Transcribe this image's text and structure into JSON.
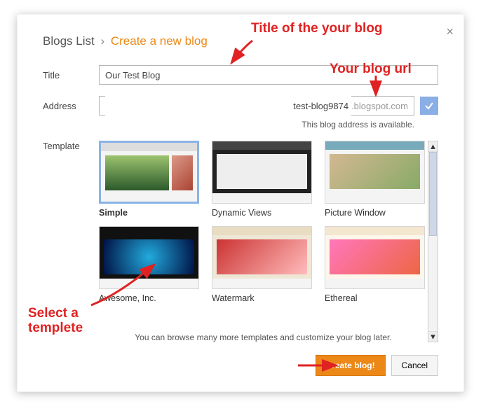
{
  "breadcrumb": {
    "list": "Blogs List",
    "sep": "›",
    "current": "Create a new blog"
  },
  "labels": {
    "title": "Title",
    "address": "Address",
    "template": "Template"
  },
  "fields": {
    "title_value": "Our Test Blog",
    "address_value": "test-blog9874",
    "address_suffix": ".blogspot.com",
    "address_status": "This blog address is available."
  },
  "templates": [
    {
      "name": "Simple",
      "selected": true,
      "style": "simple"
    },
    {
      "name": "Dynamic Views",
      "selected": false,
      "style": "dark"
    },
    {
      "name": "Picture Window",
      "selected": false,
      "style": "photo"
    },
    {
      "name": "Awesome, Inc.",
      "selected": false,
      "style": "awesome"
    },
    {
      "name": "Watermark",
      "selected": false,
      "style": "water"
    },
    {
      "name": "Ethereal",
      "selected": false,
      "style": "ether"
    }
  ],
  "browse_note": "You can browse many more templates and customize your blog later.",
  "buttons": {
    "create": "Create blog!",
    "cancel": "Cancel"
  },
  "icons": {
    "close": "×",
    "check": "✓",
    "up": "▴",
    "down": "▾"
  },
  "annotations": {
    "title": "Title of the your blog",
    "url": "Your blog url",
    "template": "Select a templete",
    "colors": {
      "text": "#e02222"
    }
  }
}
